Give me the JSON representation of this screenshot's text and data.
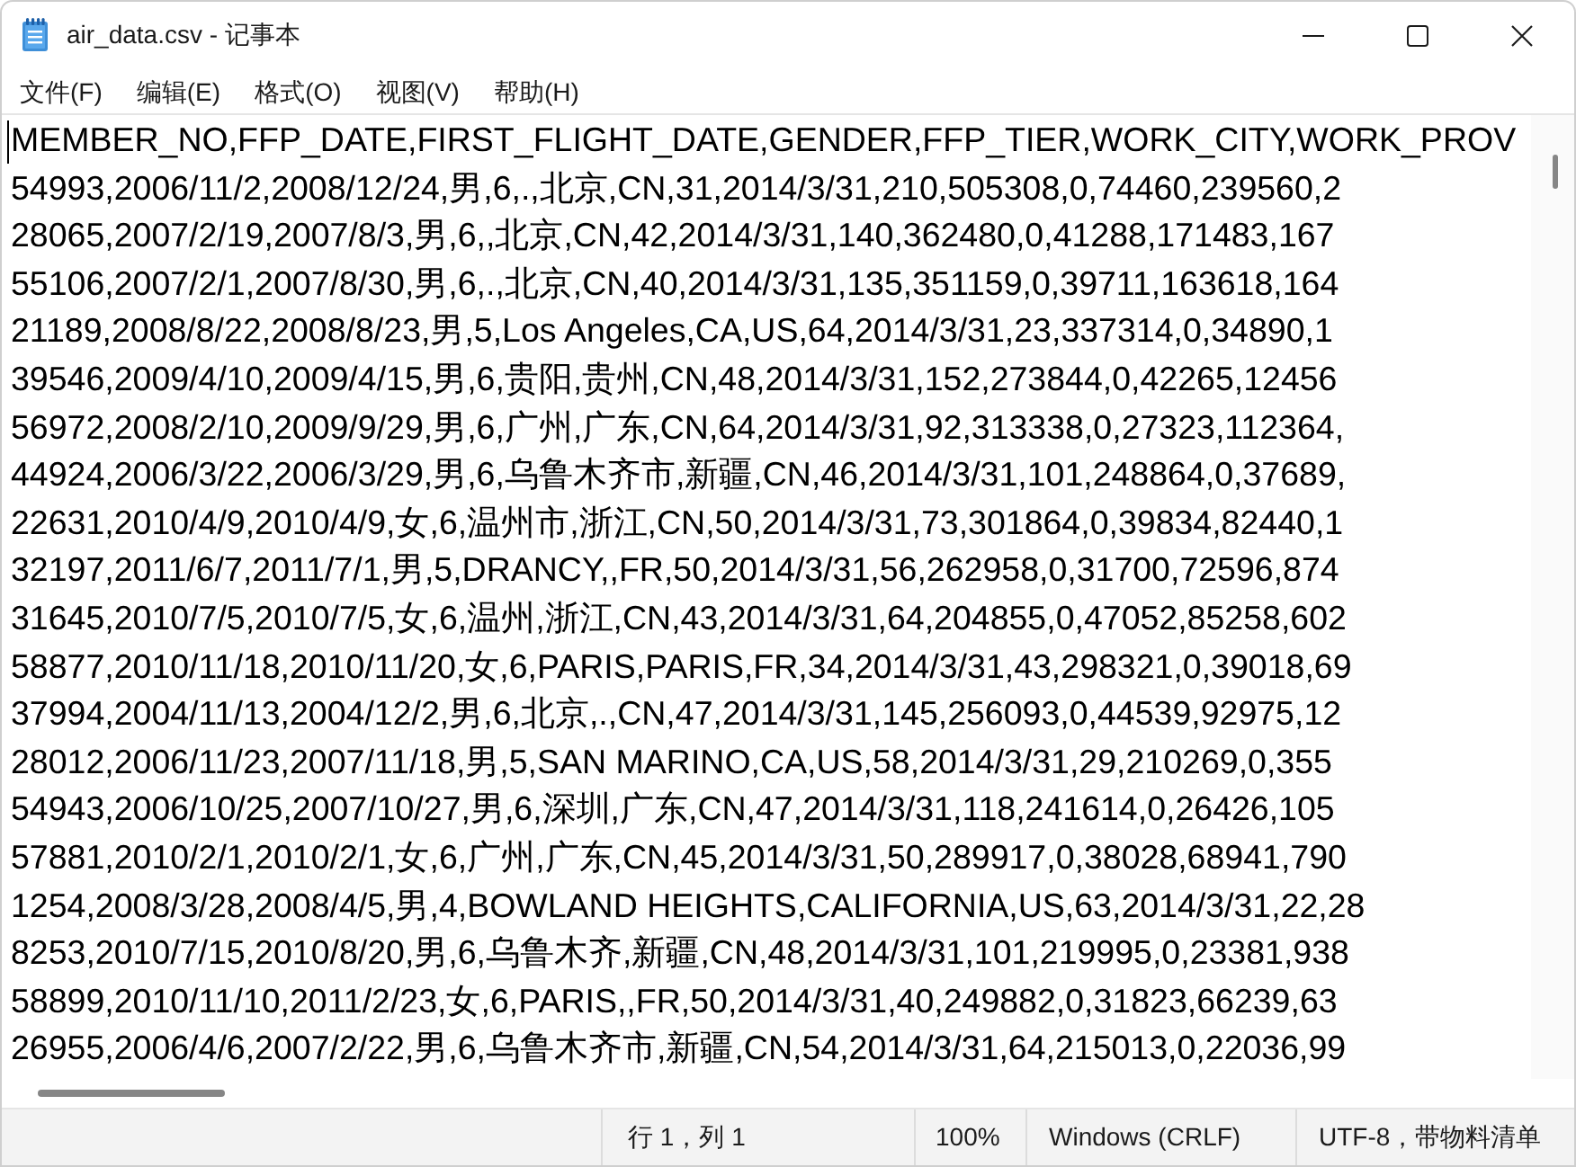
{
  "window": {
    "title": "air_data.csv - 记事本"
  },
  "menu": [
    "文件(F)",
    "编辑(E)",
    "格式(O)",
    "视图(V)",
    "帮助(H)"
  ],
  "editor": {
    "lines": [
      "MEMBER_NO,FFP_DATE,FIRST_FLIGHT_DATE,GENDER,FFP_TIER,WORK_CITY,WORK_PROV",
      "54993,2006/11/2,2008/12/24,男,6,.,北京,CN,31,2014/3/31,210,505308,0,74460,239560,2",
      "28065,2007/2/19,2007/8/3,男,6,,北京,CN,42,2014/3/31,140,362480,0,41288,171483,167",
      "55106,2007/2/1,2007/8/30,男,6,.,北京,CN,40,2014/3/31,135,351159,0,39711,163618,164",
      "21189,2008/8/22,2008/8/23,男,5,Los Angeles,CA,US,64,2014/3/31,23,337314,0,34890,1",
      "39546,2009/4/10,2009/4/15,男,6,贵阳,贵州,CN,48,2014/3/31,152,273844,0,42265,12456",
      "56972,2008/2/10,2009/9/29,男,6,广州,广东,CN,64,2014/3/31,92,313338,0,27323,112364,",
      "44924,2006/3/22,2006/3/29,男,6,乌鲁木齐市,新疆,CN,46,2014/3/31,101,248864,0,37689,",
      "22631,2010/4/9,2010/4/9,女,6,温州市,浙江,CN,50,2014/3/31,73,301864,0,39834,82440,1",
      "32197,2011/6/7,2011/7/1,男,5,DRANCY,,FR,50,2014/3/31,56,262958,0,31700,72596,874",
      "31645,2010/7/5,2010/7/5,女,6,温州,浙江,CN,43,2014/3/31,64,204855,0,47052,85258,602",
      "58877,2010/11/18,2010/11/20,女,6,PARIS,PARIS,FR,34,2014/3/31,43,298321,0,39018,69",
      "37994,2004/11/13,2004/12/2,男,6,北京,.,CN,47,2014/3/31,145,256093,0,44539,92975,12",
      "28012,2006/11/23,2007/11/18,男,5,SAN MARINO,CA,US,58,2014/3/31,29,210269,0,355",
      "54943,2006/10/25,2007/10/27,男,6,深圳,广东,CN,47,2014/3/31,118,241614,0,26426,105",
      "57881,2010/2/1,2010/2/1,女,6,广州,广东,CN,45,2014/3/31,50,289917,0,38028,68941,790",
      "1254,2008/3/28,2008/4/5,男,4,BOWLAND HEIGHTS,CALIFORNIA,US,63,2014/3/31,22,28",
      "8253,2010/7/15,2010/8/20,男,6,乌鲁木齐,新疆,CN,48,2014/3/31,101,219995,0,23381,938",
      "58899,2010/11/10,2011/2/23,女,6,PARIS,,FR,50,2014/3/31,40,249882,0,31823,66239,63",
      "26955,2006/4/6,2007/2/22,男,6,乌鲁木齐市,新疆,CN,54,2014/3/31,64,215013,0,22036,99"
    ]
  },
  "status_bar": {
    "position": "行 1，列 1",
    "zoom": "100%",
    "line_ending": "Windows (CRLF)",
    "encoding": "UTF-8，带物料清单"
  }
}
